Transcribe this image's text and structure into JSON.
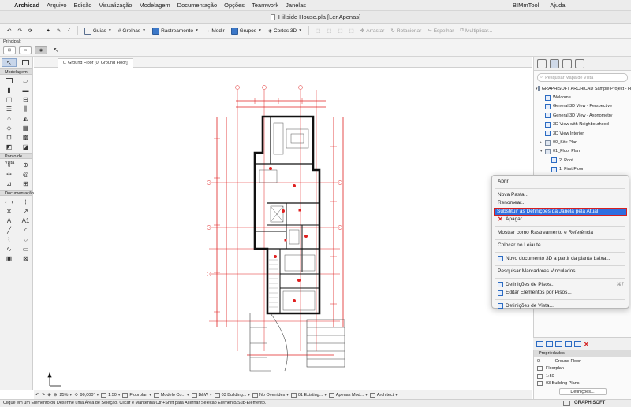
{
  "menubar": {
    "app_name": "Archicad",
    "items": [
      "Arquivo",
      "Edição",
      "Visualização",
      "Modelagem",
      "Documentação",
      "Opções",
      "Teamwork",
      "Janelas"
    ],
    "right_items": [
      "BIMmTool",
      "Ajuda"
    ]
  },
  "window": {
    "title": "Hillside House.pla [Ler Apenas]"
  },
  "toolbar": {
    "guias": "Guias",
    "grelhas": "Grelhas",
    "rastreamento": "Rastreamento",
    "medir": "Medir",
    "grupos": "Grupos",
    "cortes3d": "Cortes 3D",
    "arrastar": "Arrastar",
    "rotacionar": "Rotacionar",
    "espelhar": "Espelhar",
    "multiplicar": "Multiplicar..."
  },
  "principal": {
    "label": "Principal:"
  },
  "toolbox": {
    "sections": [
      "Modelagem",
      "Ponto de Vista",
      "Documentação"
    ],
    "tool_a1": "A1"
  },
  "tab": {
    "label": "0. Ground Floor [0. Ground Floor]"
  },
  "navigator": {
    "search_placeholder": "Pesquisar Mapa de Vista",
    "items": [
      "GRAPHISOFT ARCHICAD Sample Project - H",
      "Welcome",
      "General 3D View - Perspective",
      "General 3D View - Axonometry",
      "3D View with Neighbourhood",
      "3D View Interior",
      "00_Site Plan",
      "01_Floor Plan",
      "2. Roof",
      "1. First Floor"
    ]
  },
  "context_menu": {
    "items": [
      "Abrir",
      "Nova Pasta...",
      "Renomear...",
      "Substituir as Definições da Janela pela Atual",
      "Apagar",
      "Mostrar como Rastreamento e Referência",
      "Colocar no Leiaute",
      "Novo documento 3D a partir da planta baixa...",
      "Pesquisar Marcadores Vinculados...",
      "Definições de Pisos...",
      "Editar Elementos por Pisos...",
      "Definições de Vista..."
    ],
    "shortcut_pisos": "⌘7"
  },
  "properties": {
    "title": "Propriedades",
    "floor_num": "0.",
    "floor_name": "Ground Floor",
    "view_type": "Floorplan",
    "scale": "1:50",
    "layer_combo": "03 Building Plans",
    "button": "Definições..."
  },
  "quick_options": {
    "zoom": "25%",
    "angle": "90,000°",
    "scale": "1:50",
    "view": "Floorplan",
    "model": "Modelo Co...",
    "pen": "B&W",
    "layers": "03 Building...",
    "overrides": "No Overrides",
    "renovation": "01 Existing...",
    "markup": "Apenas Mod...",
    "dim": "Architect"
  },
  "status": {
    "text": "Clique em um Elemento ou Desenhe uma Área de Seleção. Clicar e Mantenha Ctrl+Shift para Alternar Seleção Elemento/Sub-Elemento.",
    "brand": "GRAPHISOFT"
  }
}
